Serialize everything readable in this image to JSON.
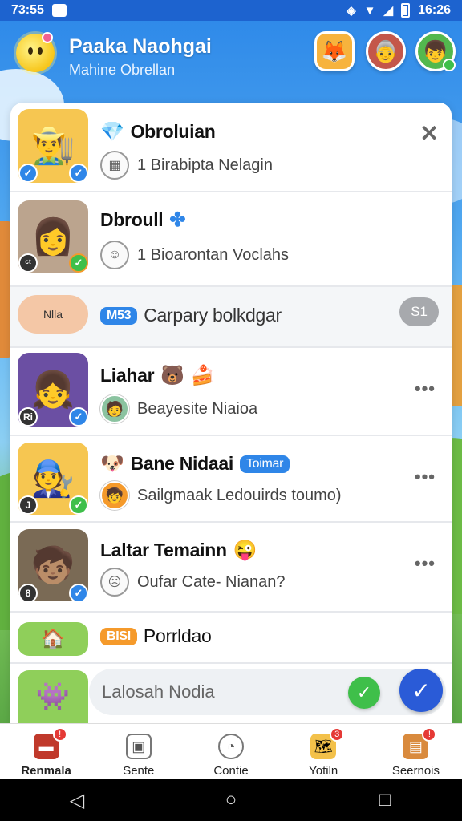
{
  "status_bar": {
    "time": "73:55",
    "clock": "16:26"
  },
  "header": {
    "title": "Paaka Naohgai",
    "subtitle": "Mahine Obrellan",
    "avatars": [
      "fox-avatar",
      "grandma-avatar",
      "boy-avatar"
    ]
  },
  "chats": [
    {
      "title": "Obroluian",
      "title_icon": "gem-icon",
      "subtitle": "1 Birabipta Nelagin",
      "sub_icon": "robot-icon",
      "action": "✕",
      "avatar": "farmer-avatar"
    },
    {
      "title": "Dbroull",
      "title_icon": "puzzle-icon",
      "subtitle": "1 Bioarontan Voclahs",
      "sub_icon": "face-icon",
      "avatar_mini": "ᶜᵗ",
      "avatar": "woman-avatar"
    },
    {
      "badge": "M53",
      "title": "Carpary bolkdgar",
      "tag": "S1",
      "thumb_label": "Nlla"
    },
    {
      "title": "Liahar",
      "subtitle": "Beayesite Niaioa",
      "more": "•••",
      "avatar_mini": "Ri",
      "avatar": "rainbow-girl-avatar"
    },
    {
      "title": "Bane Nidaai",
      "title_badge": "Toimar",
      "subtitle": "Sailgmaak Ledouirds toumo)",
      "more": "•••",
      "avatar_mini": "J",
      "avatar": "carpenter-avatar"
    },
    {
      "title": "Laltar Temainn",
      "subtitle": "Oufar Cate- Nianan?",
      "more": "•••",
      "avatar_mini": "8",
      "avatar": "boy-portrait-avatar"
    },
    {
      "badge": "BISI",
      "title": "Porrldao"
    }
  ],
  "composer": {
    "placeholder": "Lalosah Nodia"
  },
  "bottom_nav": [
    {
      "label": "Renmala",
      "badge": "!"
    },
    {
      "label": "Sente",
      "badge": ""
    },
    {
      "label": "Contie",
      "badge": ""
    },
    {
      "label": "Yotiln",
      "badge": "3"
    },
    {
      "label": "Seernois",
      "badge": "!"
    }
  ],
  "colors": {
    "primary": "#2f86e8",
    "send": "#2a5bd7",
    "online": "#3fbf4a",
    "alert": "#e53935"
  }
}
